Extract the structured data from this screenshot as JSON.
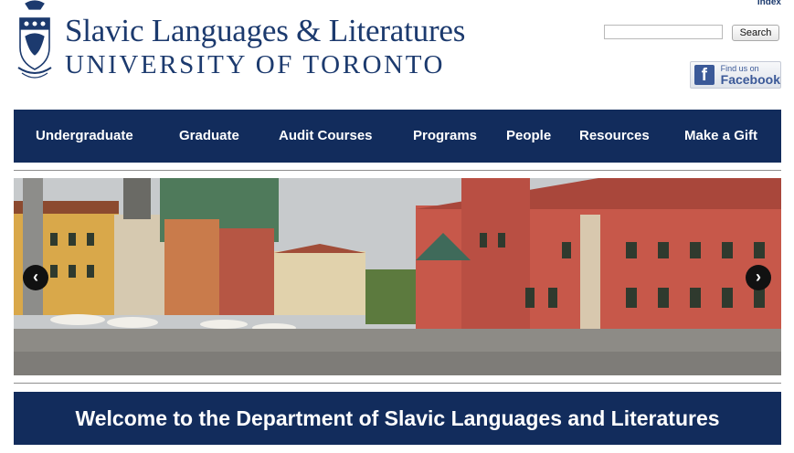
{
  "header": {
    "department": "Slavic Languages & Literatures",
    "university": "UNIVERSITY OF TORONTO",
    "crest_icon": "university-crest-icon",
    "index_link": "Index",
    "search": {
      "value": "",
      "placeholder": "",
      "button_label": "Search"
    },
    "facebook": {
      "small_text": "Find us on",
      "big_text": "Facebook",
      "icon": "facebook-icon"
    }
  },
  "nav": {
    "items": [
      {
        "label": "Undergraduate"
      },
      {
        "label": "Graduate"
      },
      {
        "label": "Audit Courses"
      },
      {
        "label": "Programs"
      },
      {
        "label": "People"
      },
      {
        "label": "Resources"
      },
      {
        "label": "Make a Gift"
      }
    ]
  },
  "slider": {
    "prev_icon": "chevron-left-icon",
    "next_icon": "chevron-right-icon",
    "image_subject": "photo-of-old-town-square-with-red-brick-castle"
  },
  "welcome": {
    "text": "Welcome to the Department of Slavic Languages and Literatures"
  },
  "colors": {
    "navy": "#122c5c",
    "title_blue": "#1c3a6e",
    "facebook_blue": "#3b5998"
  }
}
